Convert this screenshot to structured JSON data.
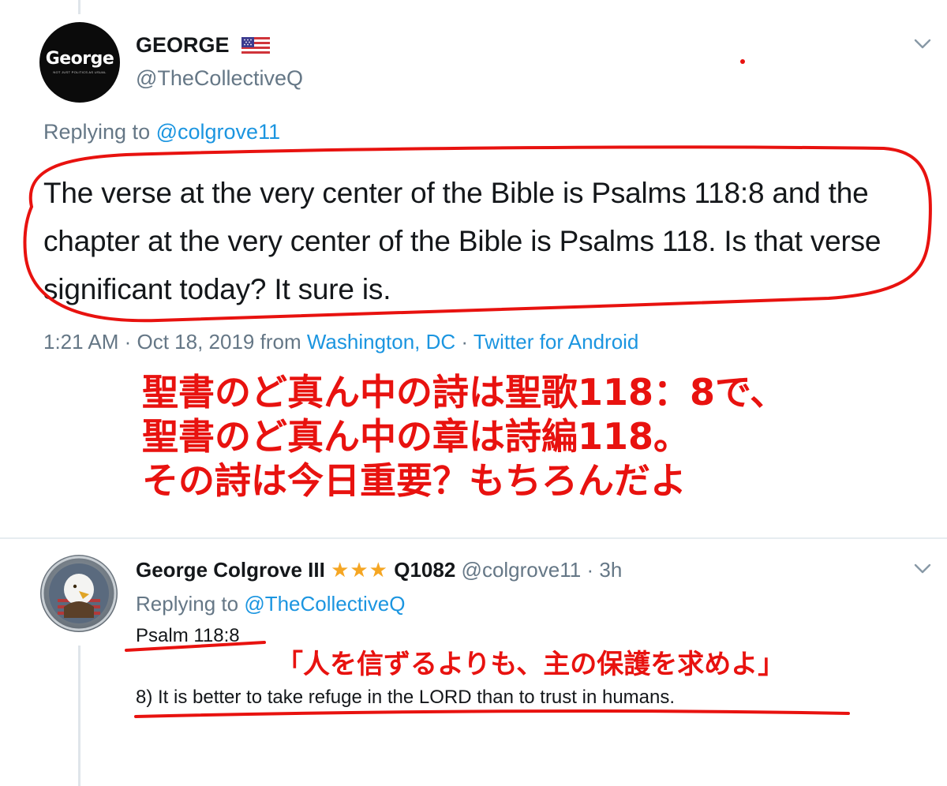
{
  "tweet1": {
    "display_name": "GEORGE",
    "handle": "@TheCollectiveQ",
    "avatar_text": "George",
    "avatar_subtext": "NOT JUST POLITICS AS USUAL",
    "flag_icon": "us-flag-icon",
    "replying_prefix": "Replying to",
    "replying_mention": "@colgrove11",
    "text": "The verse at the very center of the Bible is Psalms 118:8 and the chapter at the very center of the Bible is Psalms 118. Is that verse significant today? It sure is.",
    "time": "1:21 AM · Oct 18, 2019 from",
    "location": "Washington, DC",
    "separator": "·",
    "source": "Twitter for Android"
  },
  "annotation_jp": {
    "line1": "聖書のど真ん中の詩は聖歌118：8で、",
    "line2": "聖書のど真ん中の章は詩編118。",
    "line3": "その詩は今日重要？もちろんだよ",
    "quote": "「人を信ずるよりも、主の保護を求めよ」"
  },
  "tweet2": {
    "display_name": "George Colgrove III",
    "stars": "★★★",
    "tag": "Q1082",
    "handle": "@colgrove11",
    "time_sep": "·",
    "time": "3h",
    "replying_prefix": "Replying to",
    "replying_mention": "@TheCollectiveQ",
    "psalm_ref": "Psalm 118:8",
    "verse": "8) It is better to take refuge in the LORD than to trust in humans."
  },
  "colors": {
    "accent": "#1b95e0",
    "annotation_red": "#e8120f",
    "muted": "#657786",
    "star": "#f5a623"
  }
}
